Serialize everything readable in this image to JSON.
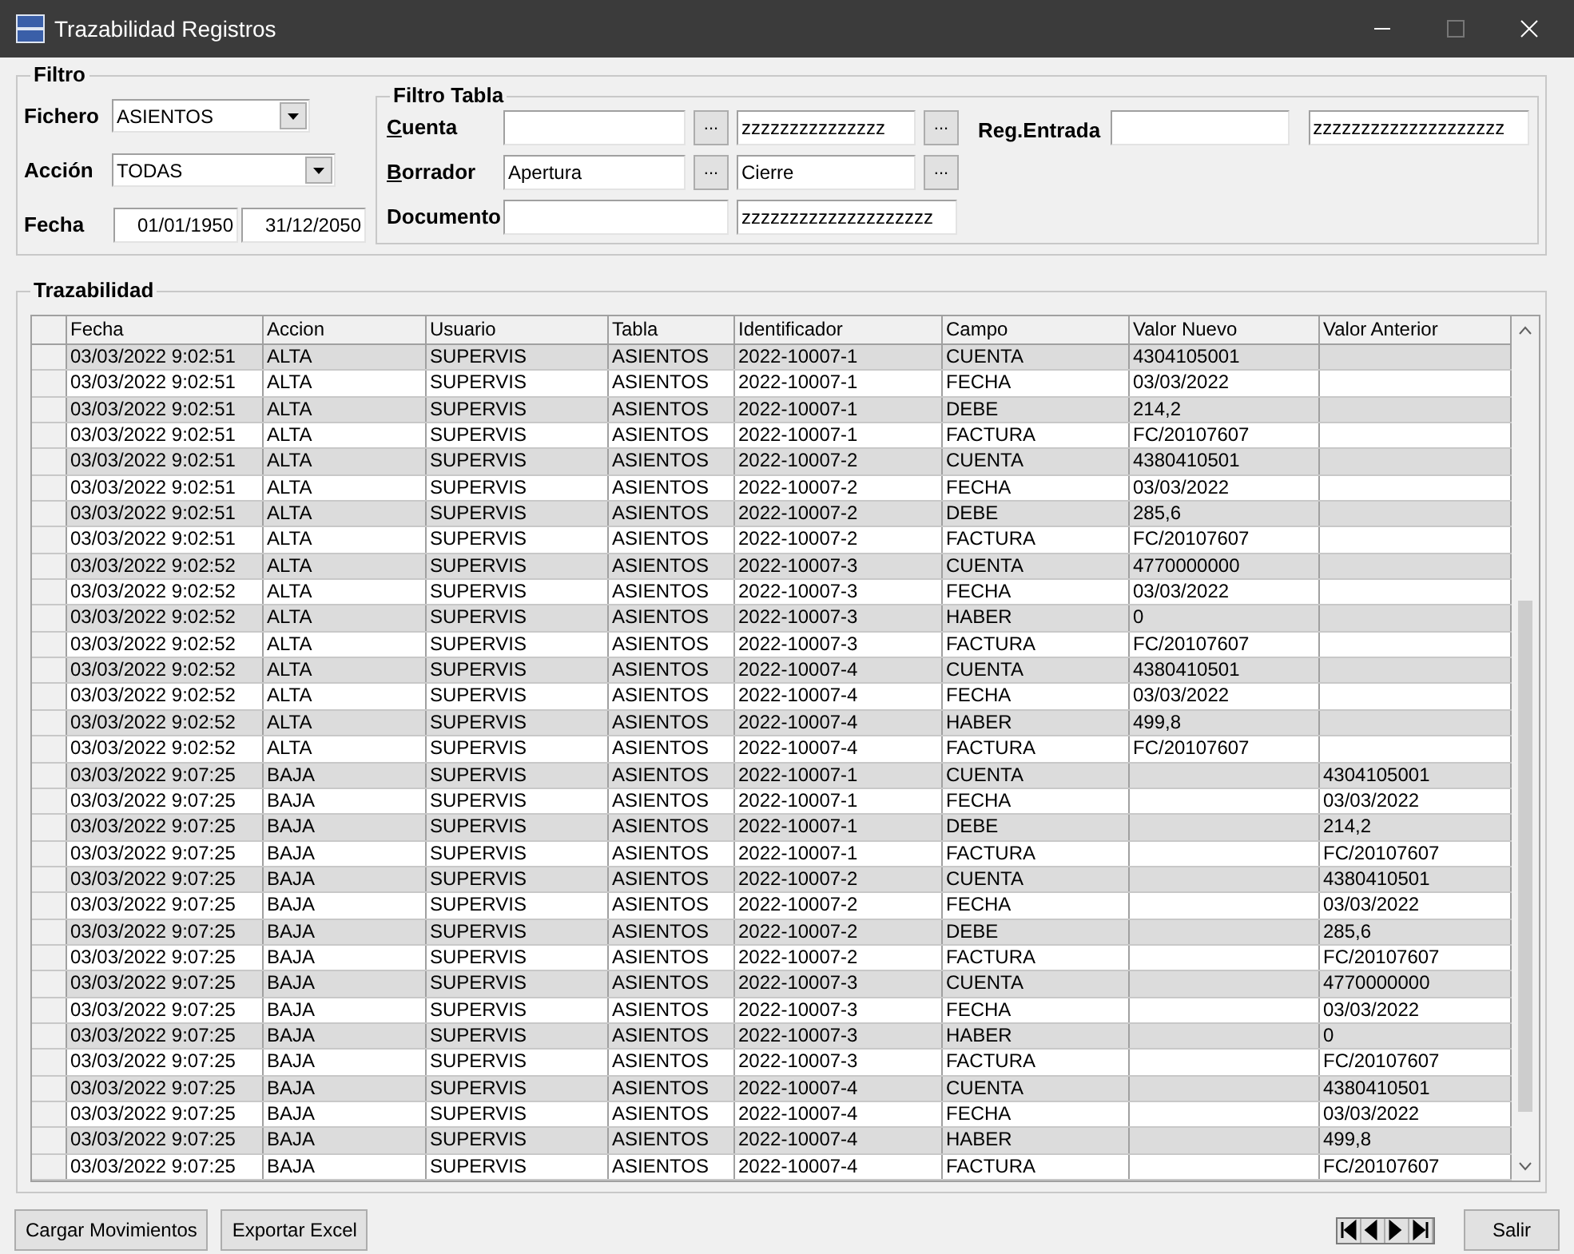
{
  "window": {
    "title": "Trazabilidad Registros"
  },
  "filtro": {
    "title": "Filtro",
    "fichero": {
      "label": "Fichero",
      "value": "ASIENTOS"
    },
    "accion": {
      "label": "Acción",
      "value": "TODAS"
    },
    "fecha": {
      "label": "Fecha",
      "from": "01/01/1950",
      "to": "31/12/2050"
    }
  },
  "filtro_tabla": {
    "title": "Filtro Tabla",
    "cuenta": {
      "label_key": "C",
      "label_rest": "uenta",
      "to": "zzzzzzzzzzzzzzz",
      "button": "..."
    },
    "borrador": {
      "label_key": "B",
      "label_rest": "orrador",
      "from": "Apertura",
      "to": "Cierre",
      "button": "..."
    },
    "documento": {
      "label": "Documento",
      "to": "zzzzzzzzzzzzzzzzzzzz"
    },
    "reg_entrada": {
      "label": "Reg.Entrada",
      "to": "zzzzzzzzzzzzzzzzzzzz"
    }
  },
  "trazabilidad": {
    "title": "Trazabilidad",
    "columns": [
      "Fecha",
      "Accion",
      "Usuario",
      "Tabla",
      "Identificador",
      "Campo",
      "Valor Nuevo",
      "Valor Anterior"
    ],
    "rows": [
      [
        "03/03/2022 9:02:51",
        "ALTA",
        "SUPERVIS",
        "ASIENTOS",
        "2022-10007-1",
        "CUENTA",
        "4304105001",
        ""
      ],
      [
        "03/03/2022 9:02:51",
        "ALTA",
        "SUPERVIS",
        "ASIENTOS",
        "2022-10007-1",
        "FECHA",
        "03/03/2022",
        ""
      ],
      [
        "03/03/2022 9:02:51",
        "ALTA",
        "SUPERVIS",
        "ASIENTOS",
        "2022-10007-1",
        "DEBE",
        "214,2",
        ""
      ],
      [
        "03/03/2022 9:02:51",
        "ALTA",
        "SUPERVIS",
        "ASIENTOS",
        "2022-10007-1",
        "FACTURA",
        "FC/20107607",
        ""
      ],
      [
        "03/03/2022 9:02:51",
        "ALTA",
        "SUPERVIS",
        "ASIENTOS",
        "2022-10007-2",
        "CUENTA",
        "4380410501",
        ""
      ],
      [
        "03/03/2022 9:02:51",
        "ALTA",
        "SUPERVIS",
        "ASIENTOS",
        "2022-10007-2",
        "FECHA",
        "03/03/2022",
        ""
      ],
      [
        "03/03/2022 9:02:51",
        "ALTA",
        "SUPERVIS",
        "ASIENTOS",
        "2022-10007-2",
        "DEBE",
        "285,6",
        ""
      ],
      [
        "03/03/2022 9:02:51",
        "ALTA",
        "SUPERVIS",
        "ASIENTOS",
        "2022-10007-2",
        "FACTURA",
        "FC/20107607",
        ""
      ],
      [
        "03/03/2022 9:02:52",
        "ALTA",
        "SUPERVIS",
        "ASIENTOS",
        "2022-10007-3",
        "CUENTA",
        "4770000000",
        ""
      ],
      [
        "03/03/2022 9:02:52",
        "ALTA",
        "SUPERVIS",
        "ASIENTOS",
        "2022-10007-3",
        "FECHA",
        "03/03/2022",
        ""
      ],
      [
        "03/03/2022 9:02:52",
        "ALTA",
        "SUPERVIS",
        "ASIENTOS",
        "2022-10007-3",
        "HABER",
        "0",
        ""
      ],
      [
        "03/03/2022 9:02:52",
        "ALTA",
        "SUPERVIS",
        "ASIENTOS",
        "2022-10007-3",
        "FACTURA",
        "FC/20107607",
        ""
      ],
      [
        "03/03/2022 9:02:52",
        "ALTA",
        "SUPERVIS",
        "ASIENTOS",
        "2022-10007-4",
        "CUENTA",
        "4380410501",
        ""
      ],
      [
        "03/03/2022 9:02:52",
        "ALTA",
        "SUPERVIS",
        "ASIENTOS",
        "2022-10007-4",
        "FECHA",
        "03/03/2022",
        ""
      ],
      [
        "03/03/2022 9:02:52",
        "ALTA",
        "SUPERVIS",
        "ASIENTOS",
        "2022-10007-4",
        "HABER",
        "499,8",
        ""
      ],
      [
        "03/03/2022 9:02:52",
        "ALTA",
        "SUPERVIS",
        "ASIENTOS",
        "2022-10007-4",
        "FACTURA",
        "FC/20107607",
        ""
      ],
      [
        "03/03/2022 9:07:25",
        "BAJA",
        "SUPERVIS",
        "ASIENTOS",
        "2022-10007-1",
        "CUENTA",
        "",
        "4304105001"
      ],
      [
        "03/03/2022 9:07:25",
        "BAJA",
        "SUPERVIS",
        "ASIENTOS",
        "2022-10007-1",
        "FECHA",
        "",
        "03/03/2022"
      ],
      [
        "03/03/2022 9:07:25",
        "BAJA",
        "SUPERVIS",
        "ASIENTOS",
        "2022-10007-1",
        "DEBE",
        "",
        "214,2"
      ],
      [
        "03/03/2022 9:07:25",
        "BAJA",
        "SUPERVIS",
        "ASIENTOS",
        "2022-10007-1",
        "FACTURA",
        "",
        "FC/20107607"
      ],
      [
        "03/03/2022 9:07:25",
        "BAJA",
        "SUPERVIS",
        "ASIENTOS",
        "2022-10007-2",
        "CUENTA",
        "",
        "4380410501"
      ],
      [
        "03/03/2022 9:07:25",
        "BAJA",
        "SUPERVIS",
        "ASIENTOS",
        "2022-10007-2",
        "FECHA",
        "",
        "03/03/2022"
      ],
      [
        "03/03/2022 9:07:25",
        "BAJA",
        "SUPERVIS",
        "ASIENTOS",
        "2022-10007-2",
        "DEBE",
        "",
        "285,6"
      ],
      [
        "03/03/2022 9:07:25",
        "BAJA",
        "SUPERVIS",
        "ASIENTOS",
        "2022-10007-2",
        "FACTURA",
        "",
        "FC/20107607"
      ],
      [
        "03/03/2022 9:07:25",
        "BAJA",
        "SUPERVIS",
        "ASIENTOS",
        "2022-10007-3",
        "CUENTA",
        "",
        "4770000000"
      ],
      [
        "03/03/2022 9:07:25",
        "BAJA",
        "SUPERVIS",
        "ASIENTOS",
        "2022-10007-3",
        "FECHA",
        "",
        "03/03/2022"
      ],
      [
        "03/03/2022 9:07:25",
        "BAJA",
        "SUPERVIS",
        "ASIENTOS",
        "2022-10007-3",
        "HABER",
        "",
        "0"
      ],
      [
        "03/03/2022 9:07:25",
        "BAJA",
        "SUPERVIS",
        "ASIENTOS",
        "2022-10007-3",
        "FACTURA",
        "",
        "FC/20107607"
      ],
      [
        "03/03/2022 9:07:25",
        "BAJA",
        "SUPERVIS",
        "ASIENTOS",
        "2022-10007-4",
        "CUENTA",
        "",
        "4380410501"
      ],
      [
        "03/03/2022 9:07:25",
        "BAJA",
        "SUPERVIS",
        "ASIENTOS",
        "2022-10007-4",
        "FECHA",
        "",
        "03/03/2022"
      ],
      [
        "03/03/2022 9:07:25",
        "BAJA",
        "SUPERVIS",
        "ASIENTOS",
        "2022-10007-4",
        "HABER",
        "",
        "499,8"
      ],
      [
        "03/03/2022 9:07:25",
        "BAJA",
        "SUPERVIS",
        "ASIENTOS",
        "2022-10007-4",
        "FACTURA",
        "",
        "FC/20107607"
      ]
    ]
  },
  "buttons": [
    "Cargar Movimientos",
    "Exportar Excel"
  ],
  "exit_button": "Salir"
}
